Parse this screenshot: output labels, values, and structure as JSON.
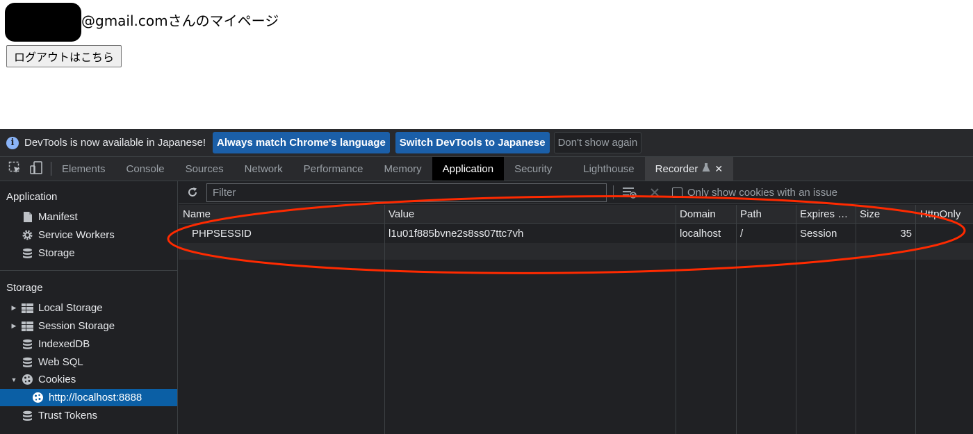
{
  "page": {
    "email_suffix": "@gmail.comさんのマイページ",
    "logout_label": "ログアウトはこちら"
  },
  "infobar": {
    "message": "DevTools is now available in Japanese!",
    "btn_match": "Always match Chrome's language",
    "btn_switch": "Switch DevTools to Japanese",
    "btn_dismiss": "Don't show again"
  },
  "tabs": [
    "Elements",
    "Console",
    "Sources",
    "Network",
    "Performance",
    "Memory",
    "Application",
    "Security",
    "Lighthouse",
    "Recorder"
  ],
  "sidebar": {
    "application_header": "Application",
    "application_items": [
      "Manifest",
      "Service Workers",
      "Storage"
    ],
    "storage_header": "Storage",
    "storage_items": [
      "Local Storage",
      "Session Storage",
      "IndexedDB",
      "Web SQL",
      "Cookies",
      "http://localhost:8888",
      "Trust Tokens"
    ]
  },
  "toolbar": {
    "filter_placeholder": "Filter",
    "only_issue_label": "Only show cookies with an issue"
  },
  "cookies_table": {
    "columns": [
      "Name",
      "Value",
      "Domain",
      "Path",
      "Expires …",
      "Size",
      "HttpOnly"
    ],
    "rows": [
      {
        "name": "PHPSESSID",
        "value": "l1u01f885bvne2s8ss07ttc7vh",
        "domain": "localhost",
        "path": "/",
        "expires": "Session",
        "size": "35",
        "httponly": ""
      }
    ]
  },
  "colors": {
    "accent_button": "#1b5fa8",
    "selected_item": "#0b5fa5",
    "annotation_ellipse": "#ff2a00"
  }
}
